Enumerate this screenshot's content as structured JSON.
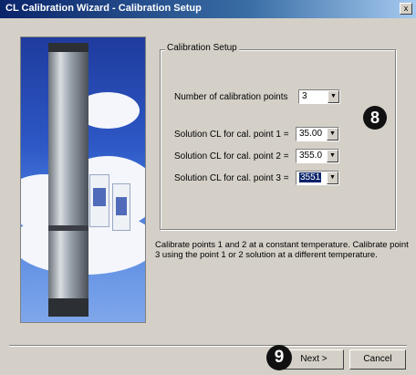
{
  "window": {
    "title": "CL Calibration Wizard - Calibration Setup",
    "close_glyph": "x"
  },
  "group": {
    "label": "Calibration Setup"
  },
  "fields": {
    "num_points": {
      "label": "Number of calibration points",
      "value": "3"
    },
    "point1": {
      "label": "Solution CL for cal. point 1 =",
      "value": "35.00"
    },
    "point2": {
      "label": "Solution CL for cal. point 2 =",
      "value": "355.0"
    },
    "point3": {
      "label": "Solution CL for cal. point 3 =",
      "value": "3551"
    }
  },
  "note": "Calibrate points 1 and 2 at a constant temperature. Calibrate point 3 using the point 1 or 2 solution at a different temperature.",
  "buttons": {
    "next": "Next >",
    "cancel": "Cancel"
  },
  "callouts": {
    "c8": "8",
    "c9": "9"
  }
}
